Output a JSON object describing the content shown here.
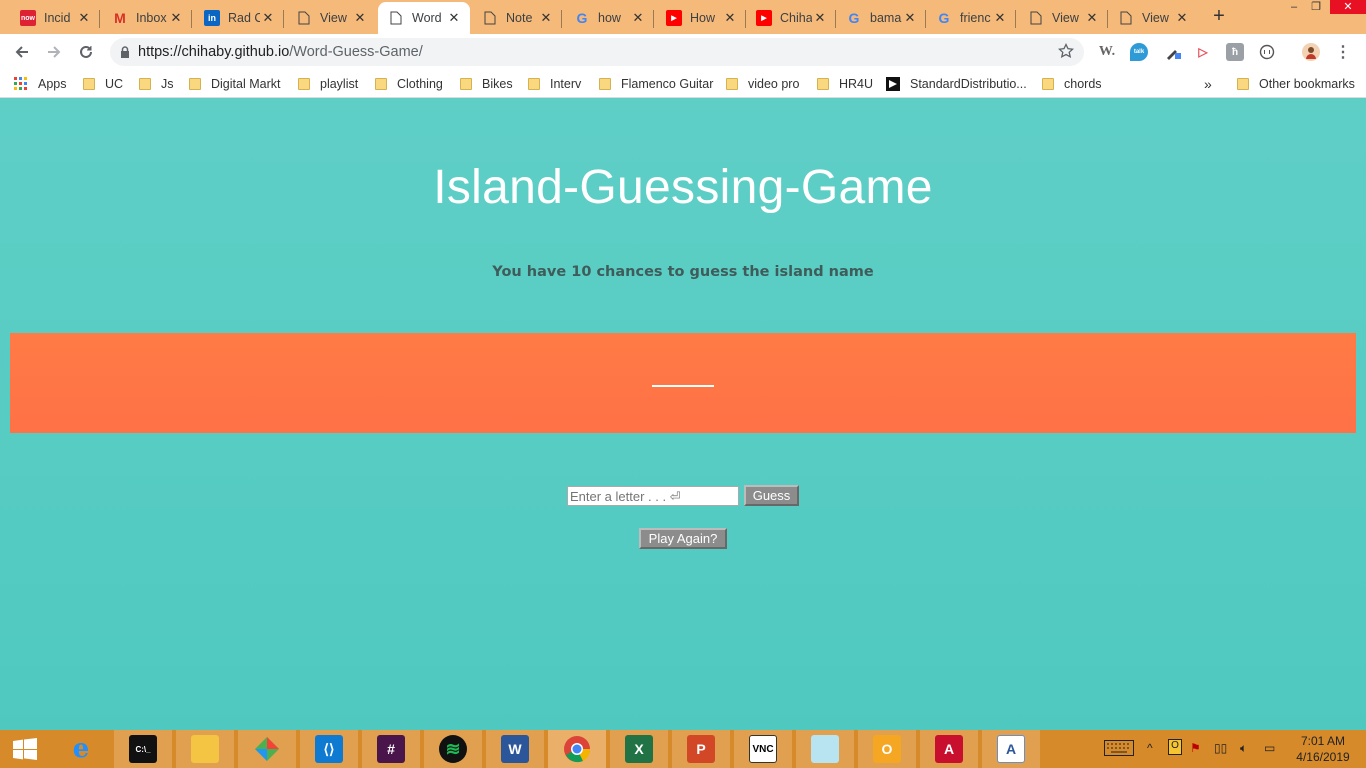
{
  "browser": {
    "tabs": [
      {
        "title": "Incid",
        "icon": "servicenow-icon"
      },
      {
        "title": "Inbox",
        "icon": "gmail-icon"
      },
      {
        "title": "Rad C",
        "icon": "linkedin-icon"
      },
      {
        "title": "View",
        "icon": "page-icon"
      },
      {
        "title": "Word",
        "icon": "page-icon",
        "active": true
      },
      {
        "title": "Note",
        "icon": "page-icon"
      },
      {
        "title": "how",
        "icon": "google-icon"
      },
      {
        "title": "How",
        "icon": "youtube-icon"
      },
      {
        "title": "Chiha",
        "icon": "youtube-icon"
      },
      {
        "title": "bama",
        "icon": "google-icon"
      },
      {
        "title": "frienc",
        "icon": "google-icon"
      },
      {
        "title": "View",
        "icon": "page-icon"
      },
      {
        "title": "View",
        "icon": "page-icon"
      }
    ],
    "url_host": "https://chihaby.github.io",
    "url_path": "/Word-Guess-Game/",
    "bookmarks": [
      "Apps",
      "UC",
      "Js",
      "Digital Markt",
      "playlist",
      "Clothing",
      "Bikes",
      "Interv",
      "Flamenco Guitar",
      "video pro",
      "HR4U",
      "StandardDistributio...",
      "chords"
    ],
    "other_bookmarks": "Other bookmarks",
    "overflow": "»"
  },
  "game": {
    "title": "Island-Guessing-Game",
    "subtitle": "You have 10 chances to guess the island name",
    "input_placeholder": "Enter a letter . . . ⏎",
    "guess_label": "Guess",
    "play_again_label": "Play Again?"
  },
  "taskbar": {
    "time": "7:01 AM",
    "date": "4/16/2019"
  },
  "colors": {
    "page_bg": "#54cbc2",
    "word_band": "#ff7646",
    "tab_strip": "#f5b97a",
    "taskbar": "#d68a2a"
  }
}
